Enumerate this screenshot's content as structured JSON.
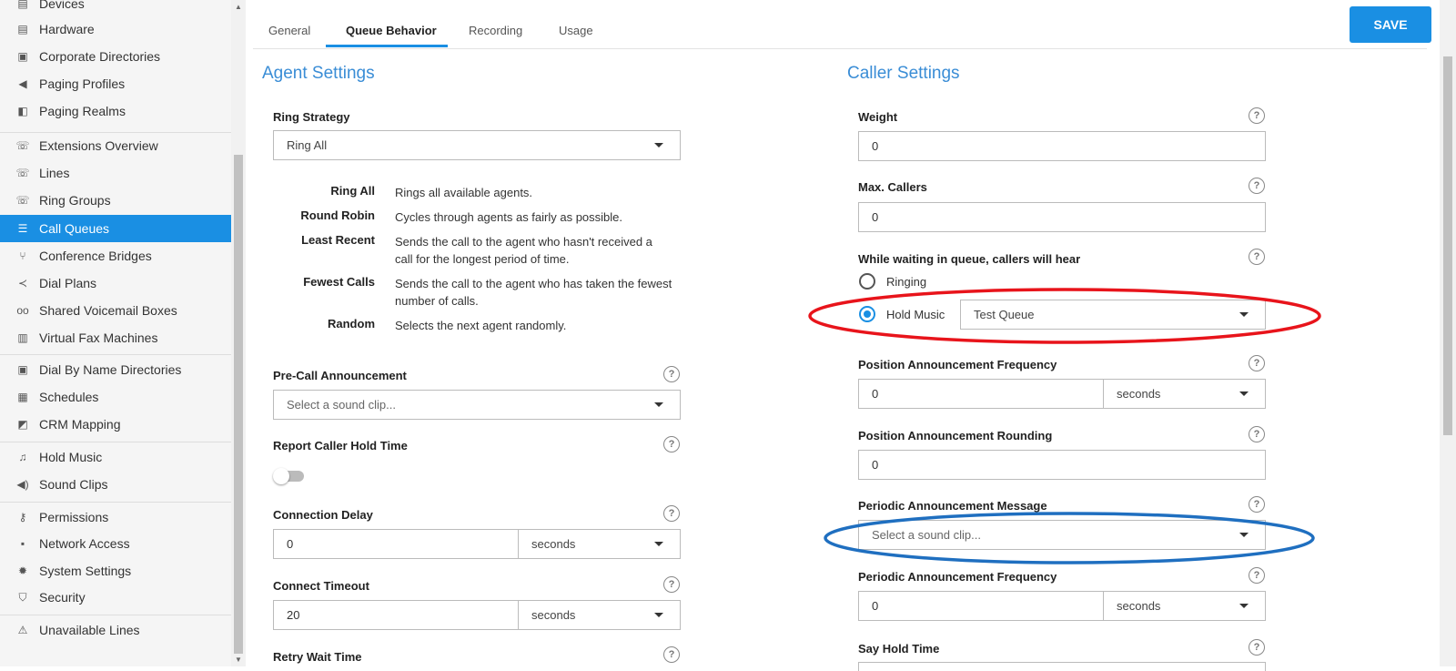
{
  "sidebar": {
    "items": [
      {
        "label": "Devices",
        "icon": "device-icon"
      },
      {
        "label": "Hardware",
        "icon": "hardware-icon"
      },
      {
        "label": "Corporate Directories",
        "icon": "directory-icon"
      },
      {
        "label": "Paging Profiles",
        "icon": "megaphone-icon"
      },
      {
        "label": "Paging Realms",
        "icon": "paging-realm-icon"
      },
      {
        "label": "Extensions Overview",
        "icon": "phone-icon"
      },
      {
        "label": "Lines",
        "icon": "phone-icon"
      },
      {
        "label": "Ring Groups",
        "icon": "ring-group-icon"
      },
      {
        "label": "Call Queues",
        "icon": "queue-list-icon"
      },
      {
        "label": "Conference Bridges",
        "icon": "conference-icon"
      },
      {
        "label": "Dial Plans",
        "icon": "dial-plan-icon"
      },
      {
        "label": "Shared Voicemail Boxes",
        "icon": "voicemail-icon"
      },
      {
        "label": "Virtual Fax Machines",
        "icon": "fax-icon"
      },
      {
        "label": "Dial By Name Directories",
        "icon": "directory-icon"
      },
      {
        "label": "Schedules",
        "icon": "calendar-icon"
      },
      {
        "label": "CRM Mapping",
        "icon": "crm-icon"
      },
      {
        "label": "Hold Music",
        "icon": "music-note-icon"
      },
      {
        "label": "Sound Clips",
        "icon": "speaker-icon"
      },
      {
        "label": "Permissions",
        "icon": "key-icon"
      },
      {
        "label": "Network Access",
        "icon": "lock-icon"
      },
      {
        "label": "System Settings",
        "icon": "gear-icon"
      },
      {
        "label": "Security",
        "icon": "shield-icon"
      },
      {
        "label": "Unavailable Lines",
        "icon": "warning-icon"
      }
    ],
    "active": "Call Queues"
  },
  "tabs": [
    "General",
    "Queue Behavior",
    "Recording",
    "Usage"
  ],
  "active_tab": "Queue Behavior",
  "save_label": "SAVE",
  "agent": {
    "title": "Agent Settings",
    "ring_strategy_label": "Ring Strategy",
    "ring_strategy_value": "Ring All",
    "strategies": [
      {
        "name": "Ring All",
        "desc": "Rings all available agents."
      },
      {
        "name": "Round Robin",
        "desc": "Cycles through agents as fairly as possible."
      },
      {
        "name": "Least Recent",
        "desc": "Sends the call to the agent who hasn't received a call for the longest period of time."
      },
      {
        "name": "Fewest Calls",
        "desc": "Sends the call to the agent who has taken the fewest number of calls."
      },
      {
        "name": "Random",
        "desc": "Selects the next agent randomly."
      }
    ],
    "pre_call_label": "Pre-Call Announcement",
    "pre_call_placeholder": "Select a sound clip...",
    "report_hold_label": "Report Caller Hold Time",
    "report_hold_on": false,
    "conn_delay_label": "Connection Delay",
    "conn_delay_value": "0",
    "conn_delay_unit": "seconds",
    "conn_timeout_label": "Connect Timeout",
    "conn_timeout_value": "20",
    "conn_timeout_unit": "seconds",
    "retry_label": "Retry Wait Time"
  },
  "caller": {
    "title": "Caller Settings",
    "weight_label": "Weight",
    "weight_value": "0",
    "max_callers_label": "Max. Callers",
    "max_callers_value": "0",
    "waiting_label": "While waiting in queue, callers will hear",
    "ringing_label": "Ringing",
    "hold_music_label": "Hold Music",
    "hold_music_value": "Test Queue",
    "selected_option": "Hold Music",
    "pos_freq_label": "Position Announcement Frequency",
    "pos_freq_value": "0",
    "pos_freq_unit": "seconds",
    "pos_round_label": "Position Announcement Rounding",
    "pos_round_value": "0",
    "periodic_msg_label": "Periodic Announcement Message",
    "periodic_msg_placeholder": "Select a sound clip...",
    "periodic_freq_label": "Periodic Announcement Frequency",
    "periodic_freq_value": "0",
    "periodic_freq_unit": "seconds",
    "say_hold_label": "Say Hold Time"
  },
  "help_glyph": "?",
  "annotations": {
    "red_ellipse_color": "#e8141b",
    "blue_ellipse_color": "#1f6fc0"
  }
}
